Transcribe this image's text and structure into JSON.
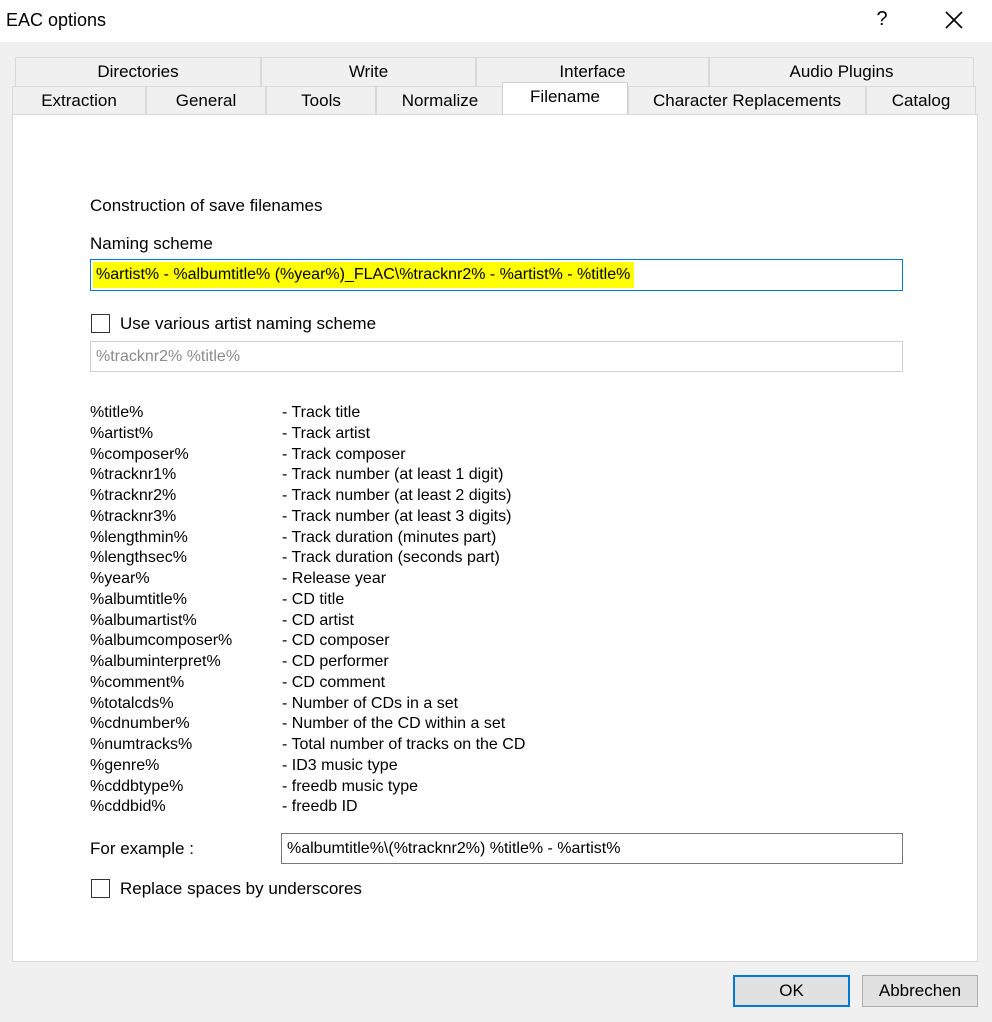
{
  "window": {
    "title": "EAC options",
    "help_label": "?"
  },
  "tabs_row1": [
    "Directories",
    "Write",
    "Interface",
    "Audio Plugins"
  ],
  "tabs_row2": [
    "Extraction",
    "General",
    "Tools",
    "Normalize",
    "Filename",
    "Character Replacements",
    "Catalog"
  ],
  "active_tab": "Filename",
  "filename": {
    "section_title": "Construction of save filenames",
    "naming_label": "Naming scheme",
    "naming_value": "%artist% - %albumtitle% (%year%)_FLAC\\%tracknr2% - %artist% - %title%",
    "various_checkbox_label": "Use various artist naming scheme",
    "various_checked": false,
    "various_value": "%tracknr2% %title%",
    "variables": [
      {
        "var": "%title%",
        "desc": "- Track title"
      },
      {
        "var": "%artist%",
        "desc": "- Track artist"
      },
      {
        "var": "%composer%",
        "desc": "- Track composer"
      },
      {
        "var": "%tracknr1%",
        "desc": "- Track number (at least 1 digit)"
      },
      {
        "var": "%tracknr2%",
        "desc": "- Track number (at least 2 digits)"
      },
      {
        "var": "%tracknr3%",
        "desc": "- Track number (at least 3 digits)"
      },
      {
        "var": "%lengthmin%",
        "desc": "- Track duration (minutes part)"
      },
      {
        "var": "%lengthsec%",
        "desc": "- Track duration (seconds part)"
      },
      {
        "var": "%year%",
        "desc": "- Release year"
      },
      {
        "var": "%albumtitle%",
        "desc": "- CD title"
      },
      {
        "var": "%albumartist%",
        "desc": "- CD artist"
      },
      {
        "var": "%albumcomposer%",
        "desc": "- CD composer"
      },
      {
        "var": "%albuminterpret%",
        "desc": "- CD performer"
      },
      {
        "var": "%comment%",
        "desc": "- CD comment"
      },
      {
        "var": "%totalcds%",
        "desc": "- Number of CDs in a set"
      },
      {
        "var": "%cdnumber%",
        "desc": "- Number of the CD within a set"
      },
      {
        "var": "%numtracks%",
        "desc": "- Total number of tracks on the CD"
      },
      {
        "var": "%genre%",
        "desc": "- ID3 music type"
      },
      {
        "var": "%cddbtype%",
        "desc": "- freedb music type"
      },
      {
        "var": "%cddbid%",
        "desc": "- freedb ID"
      }
    ],
    "example_label": "For example :",
    "example_value": "%albumtitle%\\(%tracknr2%) %title% - %artist%",
    "underscore_checkbox_label": "Replace spaces by underscores",
    "underscore_checked": false
  },
  "buttons": {
    "ok": "OK",
    "cancel": "Abbrechen"
  },
  "colors": {
    "highlight": "#ffff00",
    "focus_border": "#0078d7"
  },
  "icons": {
    "close": "close-icon"
  }
}
